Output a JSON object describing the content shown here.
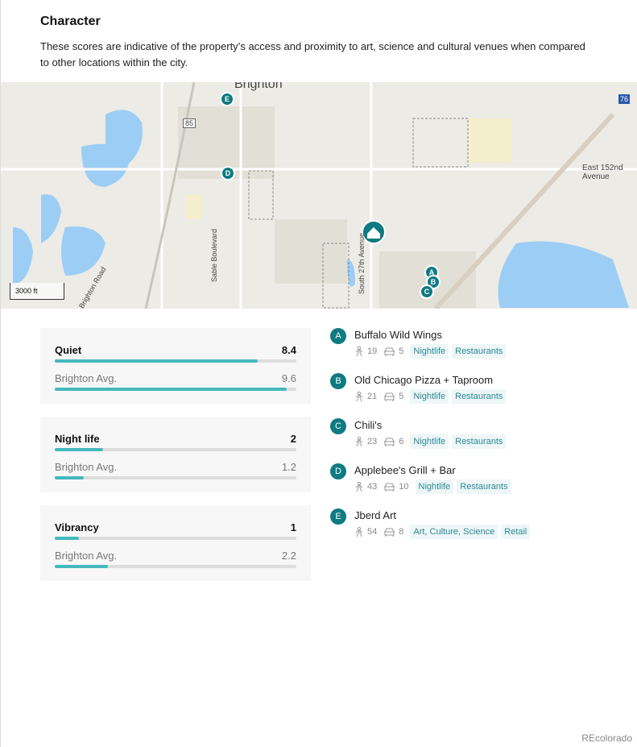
{
  "section": {
    "title": "Character",
    "description": "These scores are indicative of the property’s access and proximity to art, science and cultural venues when compared to other locations within the city."
  },
  "map": {
    "labels": {
      "city": "Brighton",
      "street1": "East 152nd Avenue",
      "street2": "Sable Boulevard",
      "street3": "South 27th Avenue",
      "street4": "Brighton Road",
      "hwy85": "85",
      "hwy76": "76"
    },
    "scale": "3000 ft",
    "markers": [
      "A",
      "B",
      "C",
      "D",
      "E"
    ],
    "home_icon": "home-icon"
  },
  "scores": [
    {
      "label": "Quiet",
      "value": "8.4",
      "pct": 84,
      "avg_label": "Brighton Avg.",
      "avg": "9.6",
      "avg_pct": 96
    },
    {
      "label": "Night life",
      "value": "2",
      "pct": 20,
      "avg_label": "Brighton Avg.",
      "avg": "1.2",
      "avg_pct": 12
    },
    {
      "label": "Vibrancy",
      "value": "1",
      "pct": 10,
      "avg_label": "Brighton Avg.",
      "avg": "2.2",
      "avg_pct": 22
    }
  ],
  "places": [
    {
      "letter": "A",
      "name": "Buffalo Wild Wings",
      "walk": "19",
      "drive": "5",
      "tags": [
        "Nightlife",
        "Restaurants"
      ]
    },
    {
      "letter": "B",
      "name": "Old Chicago Pizza + Taproom",
      "walk": "21",
      "drive": "5",
      "tags": [
        "Nightlife",
        "Restaurants"
      ]
    },
    {
      "letter": "C",
      "name": "Chili's",
      "walk": "23",
      "drive": "6",
      "tags": [
        "Nightlife",
        "Restaurants"
      ]
    },
    {
      "letter": "D",
      "name": "Applebee's Grill + Bar",
      "walk": "43",
      "drive": "10",
      "tags": [
        "Nightlife",
        "Restaurants"
      ]
    },
    {
      "letter": "E",
      "name": "Jberd Art",
      "walk": "54",
      "drive": "8",
      "tags": [
        "Art, Culture, Science",
        "Retail"
      ]
    }
  ],
  "colors": {
    "accent": "#45b8be",
    "marker": "#0f7a82",
    "water": "#9ccdf5"
  },
  "footer": "REcolorado"
}
